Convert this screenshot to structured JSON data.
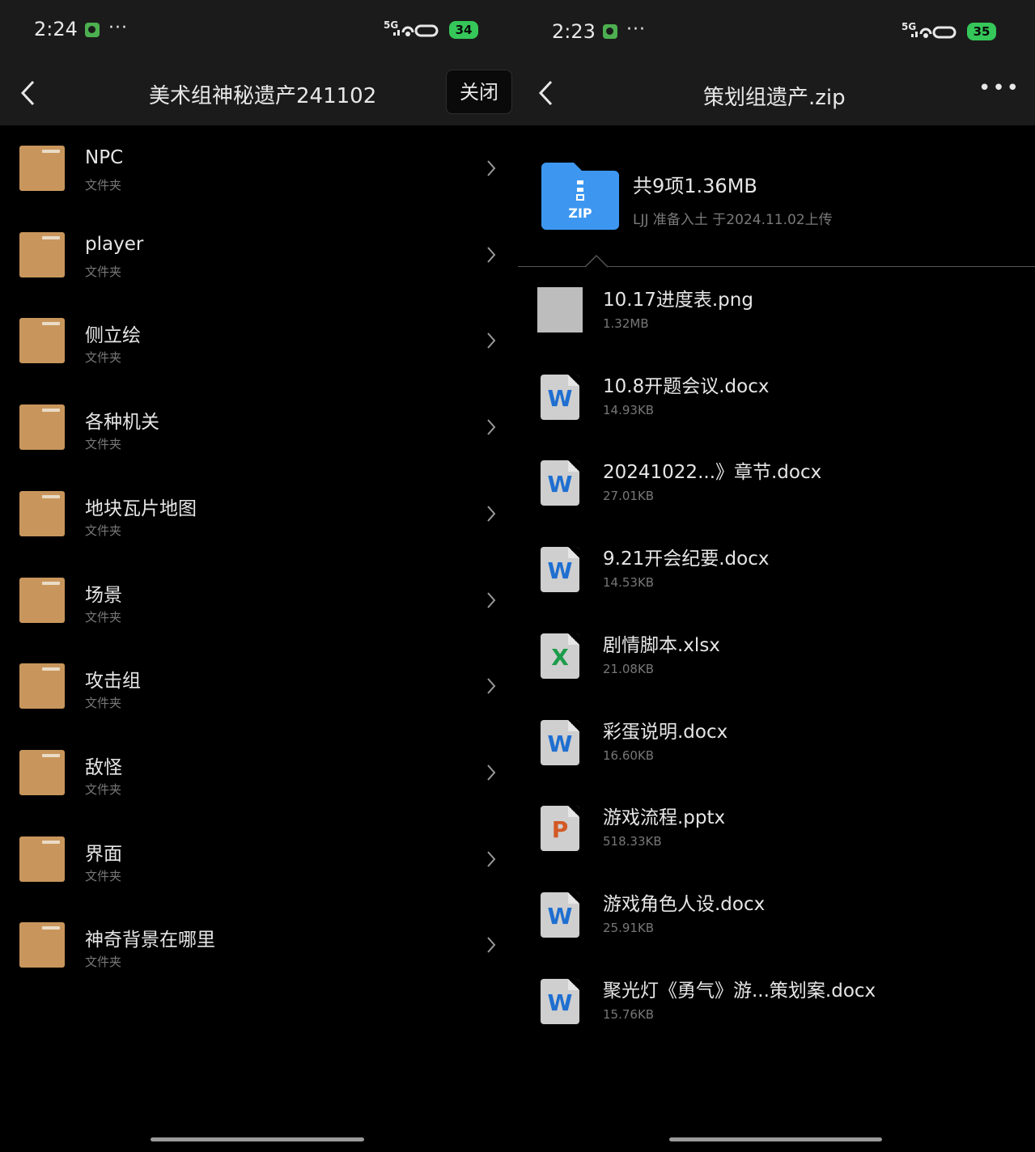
{
  "left": {
    "status": {
      "time": "2:24",
      "network": "5G",
      "battery": "34"
    },
    "header": {
      "title": "美术组神秘遗产241102",
      "close_label": "关闭"
    },
    "items": [
      {
        "name": "NPC",
        "type": "文件夹"
      },
      {
        "name": "player",
        "type": "文件夹"
      },
      {
        "name": "侧立绘",
        "type": "文件夹"
      },
      {
        "name": "各种机关",
        "type": "文件夹"
      },
      {
        "name": "地块瓦片地图",
        "type": "文件夹"
      },
      {
        "name": "场景",
        "type": "文件夹"
      },
      {
        "name": "攻击组",
        "type": "文件夹"
      },
      {
        "name": "敌怪",
        "type": "文件夹"
      },
      {
        "name": "界面",
        "type": "文件夹"
      },
      {
        "name": "神奇背景在哪里",
        "type": "文件夹"
      }
    ]
  },
  "right": {
    "status": {
      "time": "2:23",
      "network": "5G",
      "battery": "35"
    },
    "header": {
      "title": "策划组遗产.zip"
    },
    "zip": {
      "icon_label": "ZIP",
      "summary": "共9项1.36MB",
      "meta": "LJJ  准备入土 于2024.11.02上传"
    },
    "files": [
      {
        "name": "10.17进度表.png",
        "size": "1.32MB",
        "icon": "image-icon",
        "letter": ""
      },
      {
        "name": "10.8开题会议.docx",
        "size": "14.93KB",
        "icon": "word-icon",
        "letter": "W"
      },
      {
        "name": "20241022...》章节.docx",
        "size": "27.01KB",
        "icon": "word-icon",
        "letter": "W"
      },
      {
        "name": "9.21开会纪要.docx",
        "size": "14.53KB",
        "icon": "word-icon",
        "letter": "W"
      },
      {
        "name": "剧情脚本.xlsx",
        "size": "21.08KB",
        "icon": "excel-icon",
        "letter": "X"
      },
      {
        "name": "彩蛋说明.docx",
        "size": "16.60KB",
        "icon": "word-icon",
        "letter": "W"
      },
      {
        "name": "游戏流程.pptx",
        "size": "518.33KB",
        "icon": "powerpoint-icon",
        "letter": "P"
      },
      {
        "name": "游戏角色人设.docx",
        "size": "25.91KB",
        "icon": "word-icon",
        "letter": "W"
      },
      {
        "name": "聚光灯《勇气》游...策划案.docx",
        "size": "15.76KB",
        "icon": "word-icon",
        "letter": "W"
      }
    ]
  },
  "colors": {
    "folder": "#c8965c",
    "word": "#1f6fd1",
    "excel": "#1d9c4a",
    "powerpoint": "#d35a25",
    "zip": "#3d97f0",
    "battery": "#35c759"
  }
}
